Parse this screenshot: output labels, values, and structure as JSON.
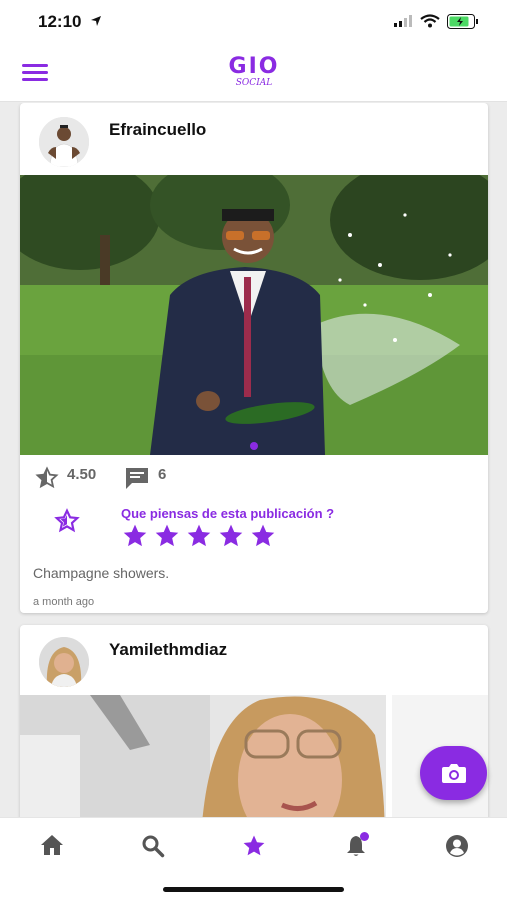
{
  "status_bar": {
    "time": "12:10"
  },
  "colors": {
    "accent": "#8a2be2",
    "icon_gray": "#555555"
  },
  "app_bar": {
    "menu_icon": "hamburger-menu-icon",
    "logo_main": "GIO",
    "logo_sub": "SOCIAL"
  },
  "posts": [
    {
      "username": "Efraincuello",
      "rating": "4.50",
      "comments": "6",
      "rate_prompt": "Que piensas de esta publicación ?",
      "caption": "Champagne showers.",
      "time_ago": "a month ago",
      "star_count": 5
    },
    {
      "username": "Yamilethmdiaz"
    }
  ],
  "fab": {
    "icon": "camera-icon"
  },
  "bottom_nav": [
    {
      "icon": "home-icon"
    },
    {
      "icon": "search-icon"
    },
    {
      "icon": "star-icon",
      "active": true
    },
    {
      "icon": "bell-icon",
      "badge": true
    },
    {
      "icon": "profile-icon"
    }
  ]
}
